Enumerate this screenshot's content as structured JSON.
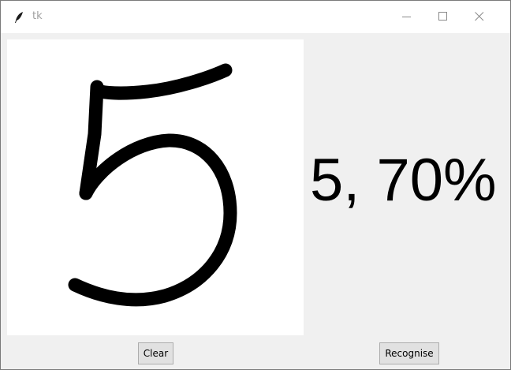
{
  "window": {
    "title": "tk",
    "app_icon": "feather-icon",
    "controls": [
      "minimize-icon",
      "maximize-icon",
      "close-icon"
    ]
  },
  "drawing_canvas": {
    "content": "hand-drawn digit 5"
  },
  "prediction": {
    "text": "5, 70%"
  },
  "buttons": {
    "clear_label": "Clear",
    "recognise_label": "Recognise"
  }
}
